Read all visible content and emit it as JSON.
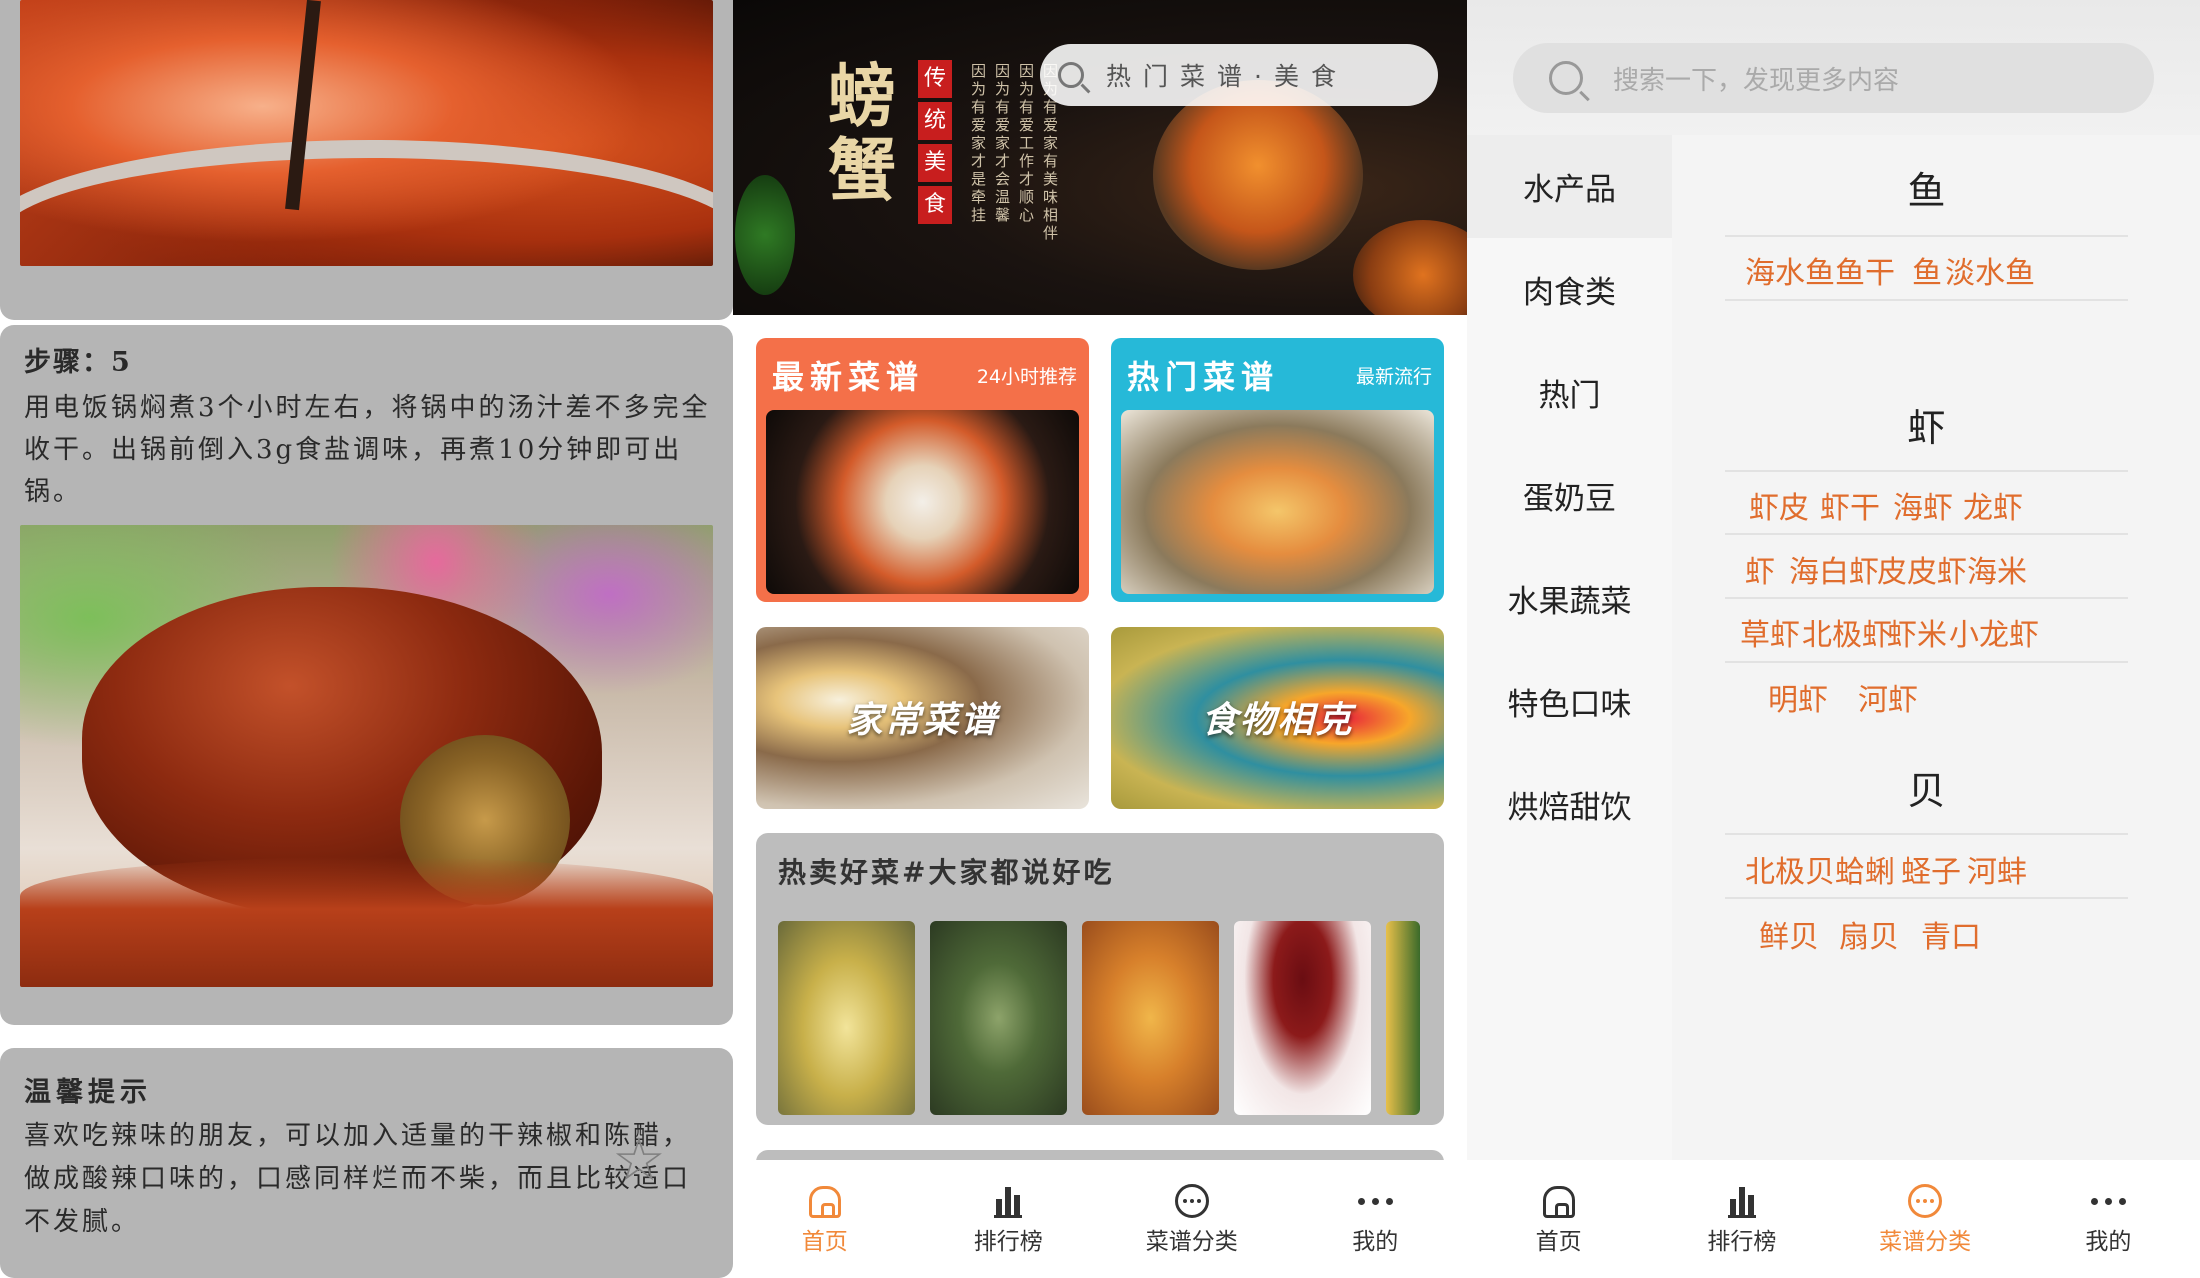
{
  "detail": {
    "step_title": "步骤：5",
    "step_body": "用电饭锅焖煮3个小时左右，将锅中的汤汁差不多完全收干。出锅前倒入3g食盐调味，再煮10分钟即可出锅。",
    "tip_title": "温馨提示",
    "tip_body": "喜欢吃辣味的朋友，可以加入适量的干辣椒和陈醋，做成酸辣口味的，口感同样烂而不柴，而且比较适口不发腻。"
  },
  "home": {
    "banner": {
      "big_text": "螃蟹",
      "tags": [
        "传",
        "统",
        "美",
        "食"
      ],
      "columns": [
        "因为有爱家才是牵挂",
        "因为有爱家才会温馨",
        "因为有爱工作才顺心",
        "因为有爱家有美味相伴"
      ]
    },
    "search_text": "热门菜谱·美食",
    "tiles": [
      {
        "title": "最新菜谱",
        "subtitle": "24小时推荐"
      },
      {
        "title": "热门菜谱",
        "subtitle": "最新流行"
      }
    ],
    "image_tiles": [
      "家常菜谱",
      "食物相克"
    ],
    "hot_sale_title": "热卖好菜#大家都说好吃"
  },
  "tabbar_home": [
    {
      "label": "首页",
      "icon": "home-icon",
      "active": true
    },
    {
      "label": "排行榜",
      "icon": "bar-chart-icon",
      "active": false
    },
    {
      "label": "菜谱分类",
      "icon": "chat-bubble-icon",
      "active": false
    },
    {
      "label": "我的",
      "icon": "more-dots-icon",
      "active": false
    }
  ],
  "category": {
    "search_placeholder": "搜索一下，发现更多内容",
    "sidebar": [
      "水产品",
      "肉食类",
      "热门",
      "蛋奶豆",
      "水果蔬菜",
      "特色口味",
      "烘焙甜饮"
    ],
    "groups": [
      {
        "title": "鱼",
        "items": [
          "海水鱼",
          "鱼干",
          "鱼",
          "淡水鱼"
        ]
      },
      {
        "title": "虾",
        "items": [
          "虾皮",
          "虾干",
          "海虾",
          "龙虾",
          "虾",
          "海白虾",
          "皮皮虾",
          "海米",
          "草虾",
          "北极虾",
          "虾米",
          "小龙虾",
          "明虾",
          "河虾"
        ]
      },
      {
        "title": "贝",
        "items": [
          "北极贝",
          "蛤蜊",
          "蛏子",
          "河蚌",
          "鲜贝",
          "扇贝",
          "青口"
        ]
      }
    ]
  },
  "tabbar_category": [
    {
      "label": "首页",
      "icon": "home-icon",
      "active": false
    },
    {
      "label": "排行榜",
      "icon": "bar-chart-icon",
      "active": false
    },
    {
      "label": "菜谱分类",
      "icon": "chat-bubble-icon",
      "active": true
    },
    {
      "label": "我的",
      "icon": "more-dots-icon",
      "active": false
    }
  ],
  "colors": {
    "accent": "#f1893a",
    "category_item": "#e06d2d",
    "new_tile": "#f47049",
    "hot_tile": "#26b9d8"
  }
}
